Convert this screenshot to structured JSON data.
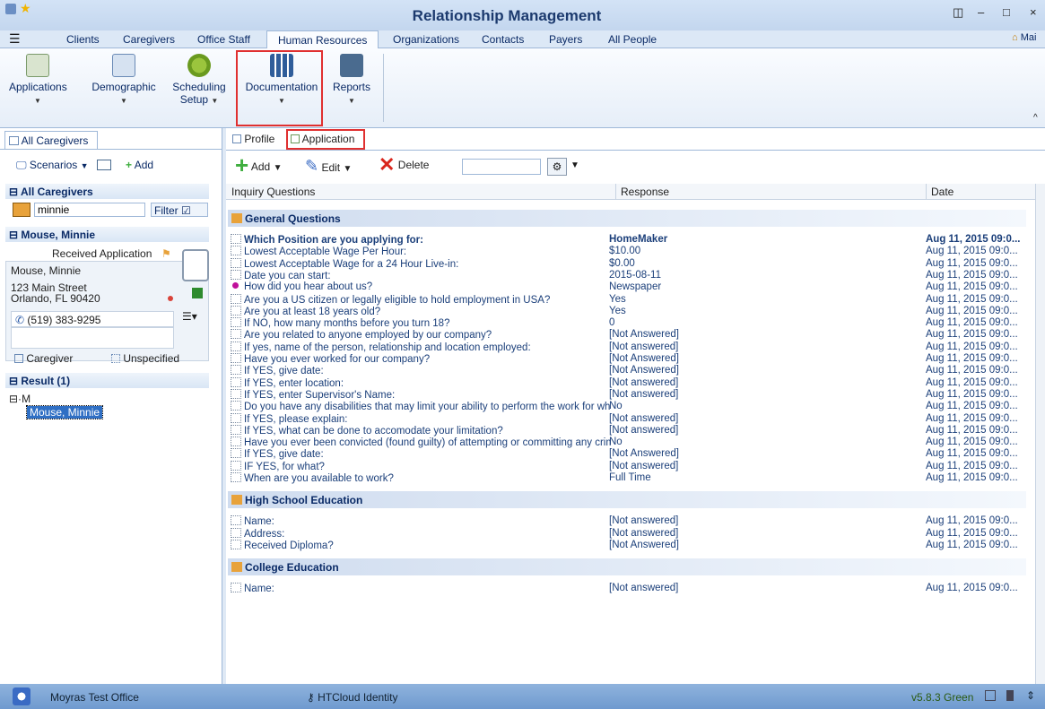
{
  "app": {
    "title": "Relationship Management",
    "min": "–",
    "max": "□",
    "close": "×",
    "restore": "◫"
  },
  "nav": {
    "menu_icon": "hamburger-icon",
    "tabs": [
      "Clients",
      "Caregivers",
      "Office Staff",
      "Human Resources",
      "Organizations",
      "Contacts",
      "Payers",
      "All People"
    ],
    "active": "Human Resources",
    "main_link": "Mai"
  },
  "ribbon": {
    "buttons": [
      "Applications",
      "Demographic",
      "Scheduling",
      "Documentation",
      "Reports"
    ],
    "scheduling_sub": "Setup"
  },
  "left": {
    "tab": "All Caregivers",
    "scenarios": "Scenarios",
    "add": "Add",
    "section_all": "All Caregivers",
    "search_value": "minnie",
    "filter": "Filter",
    "section_person": "Mouse, Minnie",
    "status": "Received Application",
    "card_name": "Mouse, Minnie",
    "addr1": "123 Main Street",
    "addr2": "Orlando, FL 90420",
    "phone": "(519) 383-9295",
    "type1": "Caregiver",
    "type2": "Unspecified",
    "section_result": "Result (1)",
    "tree_root": "M",
    "tree_item": "Mouse, Minnie"
  },
  "right": {
    "tabs": [
      "Profile",
      "Application"
    ],
    "toolbar": {
      "add": "Add",
      "edit": "Edit",
      "delete": "Delete",
      "search_value": ""
    },
    "columns": [
      "Inquiry Questions",
      "Response",
      "Date"
    ],
    "groups": [
      {
        "name": "General Questions",
        "rows": [
          [
            "Which Position are you applying for:",
            "HomeMaker",
            "Aug 11, 2015 09:0..."
          ],
          [
            "Lowest Acceptable Wage Per Hour:",
            "$10.00",
            "Aug 11, 2015 09:0..."
          ],
          [
            "Lowest Acceptable Wage for a 24 Hour Live-in:",
            "$0.00",
            "Aug 11, 2015 09:0..."
          ],
          [
            "Date you can start:",
            "2015-08-11",
            "Aug 11, 2015 09:0..."
          ],
          [
            "How did you hear about us?",
            "Newspaper",
            "Aug 11, 2015 09:0..."
          ],
          [
            "Are you a US citizen or legally eligible to hold employment in USA?",
            "Yes",
            "Aug 11, 2015 09:0..."
          ],
          [
            "Are you at least 18 years old?",
            "Yes",
            "Aug 11, 2015 09:0..."
          ],
          [
            "If NO, how many months before you turn 18?",
            "0",
            "Aug 11, 2015 09:0..."
          ],
          [
            "Are you related to anyone employed by our company?",
            "[Not Answered]",
            "Aug 11, 2015 09:0..."
          ],
          [
            "If yes, name of the person, relationship and location employed:",
            "[Not answered]",
            "Aug 11, 2015 09:0..."
          ],
          [
            "Have you ever worked for our company?",
            "[Not Answered]",
            "Aug 11, 2015 09:0..."
          ],
          [
            "If YES, give date:",
            "[Not Answered]",
            "Aug 11, 2015 09:0..."
          ],
          [
            "If YES, enter location:",
            "[Not answered]",
            "Aug 11, 2015 09:0..."
          ],
          [
            "If YES, enter Supervisor's Name:",
            "[Not answered]",
            "Aug 11, 2015 09:0..."
          ],
          [
            "Do you have any disabilities that may limit your ability to perform the work for which",
            "No",
            "Aug 11, 2015 09:0..."
          ],
          [
            "If YES, please explain:",
            "[Not answered]",
            "Aug 11, 2015 09:0..."
          ],
          [
            "If YES, what can be done to accomodate your limitation?",
            "[Not answered]",
            "Aug 11, 2015 09:0..."
          ],
          [
            "Have you ever been convicted (found guilty) of attempting or committing any crime",
            "No",
            "Aug 11, 2015 09:0..."
          ],
          [
            "If YES, give date:",
            "[Not Answered]",
            "Aug 11, 2015 09:0..."
          ],
          [
            "IF YES, for what?",
            "[Not answered]",
            "Aug 11, 2015 09:0..."
          ],
          [
            "When are you available to work?",
            "Full Time",
            "Aug 11, 2015 09:0..."
          ]
        ]
      },
      {
        "name": "High School Education",
        "rows": [
          [
            "Name:",
            "[Not answered]",
            "Aug 11, 2015 09:0..."
          ],
          [
            "Address:",
            "[Not answered]",
            "Aug 11, 2015 09:0..."
          ],
          [
            "Received Diploma?",
            "[Not Answered]",
            "Aug 11, 2015 09:0..."
          ]
        ]
      },
      {
        "name": "College Education",
        "rows": [
          [
            "Name:",
            "[Not answered]",
            "Aug 11, 2015 09:0..."
          ]
        ]
      }
    ]
  },
  "status": {
    "office": "Moyras Test Office",
    "identity": "HTCloud Identity",
    "version": "v5.8.3 Green"
  }
}
